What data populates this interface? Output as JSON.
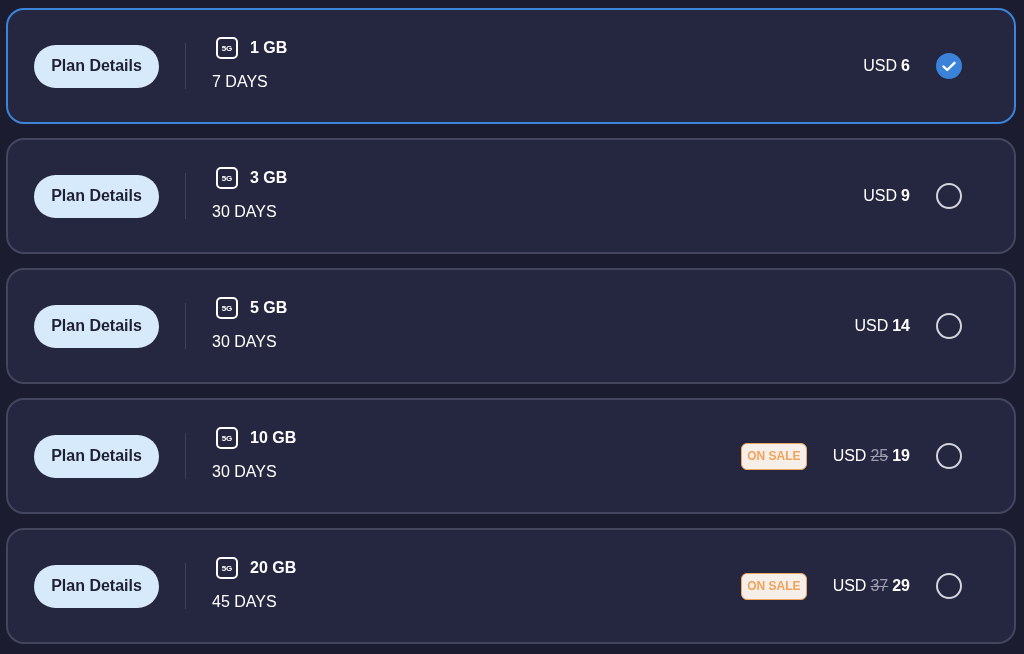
{
  "plans": [
    {
      "details_button": "Plan Details",
      "network_badge": "5G",
      "data": "1 GB",
      "duration": "7 DAYS",
      "currency": "USD",
      "price": "6",
      "selected": true
    },
    {
      "details_button": "Plan Details",
      "network_badge": "5G",
      "data": "3 GB",
      "duration": "30 DAYS",
      "currency": "USD",
      "price": "9",
      "selected": false
    },
    {
      "details_button": "Plan Details",
      "network_badge": "5G",
      "data": "5 GB",
      "duration": "30 DAYS",
      "currency": "USD",
      "price": "14",
      "selected": false
    },
    {
      "details_button": "Plan Details",
      "network_badge": "5G",
      "data": "10 GB",
      "duration": "30 DAYS",
      "sale_badge": "ON SALE",
      "currency": "USD",
      "old_price": "25",
      "price": "19",
      "selected": false
    },
    {
      "details_button": "Plan Details",
      "network_badge": "5G",
      "data": "20 GB",
      "duration": "45 DAYS",
      "sale_badge": "ON SALE",
      "currency": "USD",
      "old_price": "37",
      "price": "29",
      "selected": false
    }
  ]
}
